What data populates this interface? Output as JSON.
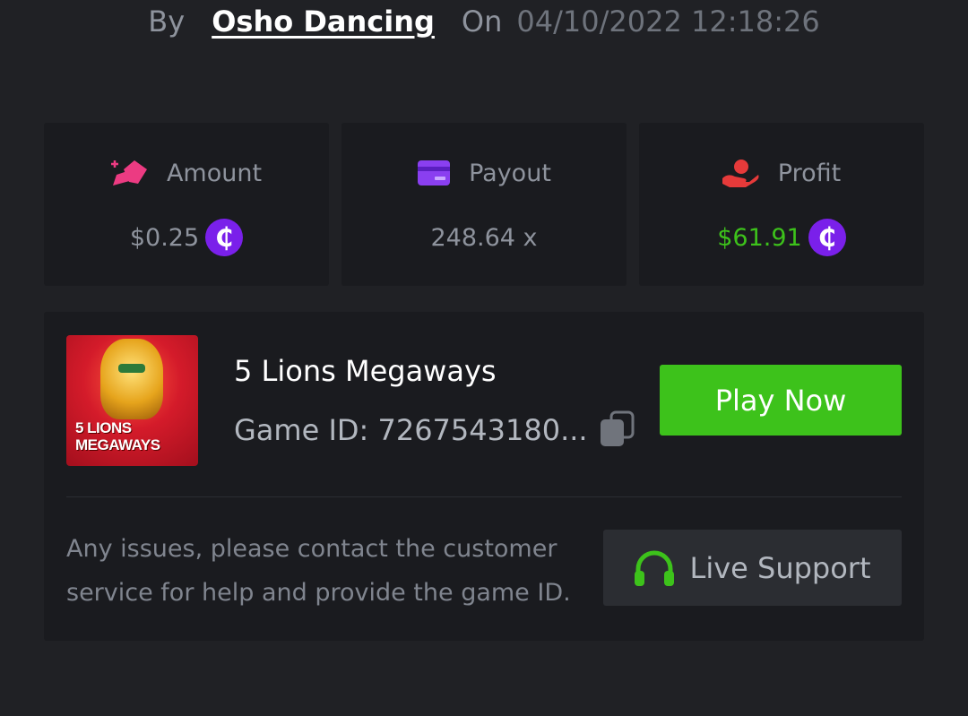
{
  "header": {
    "by_label": "By",
    "author": "Osho Dancing",
    "on_label": "On",
    "datetime": "04/10/2022 12:18:26"
  },
  "stats": {
    "amount": {
      "label": "Amount",
      "value": "$0.25",
      "icon": "amount-icon",
      "icon_color": "#ec3b82"
    },
    "payout": {
      "label": "Payout",
      "value": "248.64 x",
      "icon": "card-icon",
      "icon_color": "#8a3ff0"
    },
    "profit": {
      "label": "Profit",
      "value": "$61.91",
      "icon": "hand-coin-icon",
      "icon_color": "#e63a3a",
      "value_color": "#3dc21b"
    },
    "coin_symbol": "₵",
    "coin_color": "#7a20ea"
  },
  "game": {
    "thumbnail_text_line1": "5 LIONS",
    "thumbnail_text_line2": "MEGAWAYS",
    "title": "5 Lions Megaways",
    "id_text": "Game ID: 7267543180...",
    "play_label": "Play Now",
    "play_color": "#3dc21b"
  },
  "help": {
    "text": "Any issues, please contact the customer service for help and provide the game ID.",
    "support_label": "Live Support",
    "support_icon": "headset-icon"
  }
}
